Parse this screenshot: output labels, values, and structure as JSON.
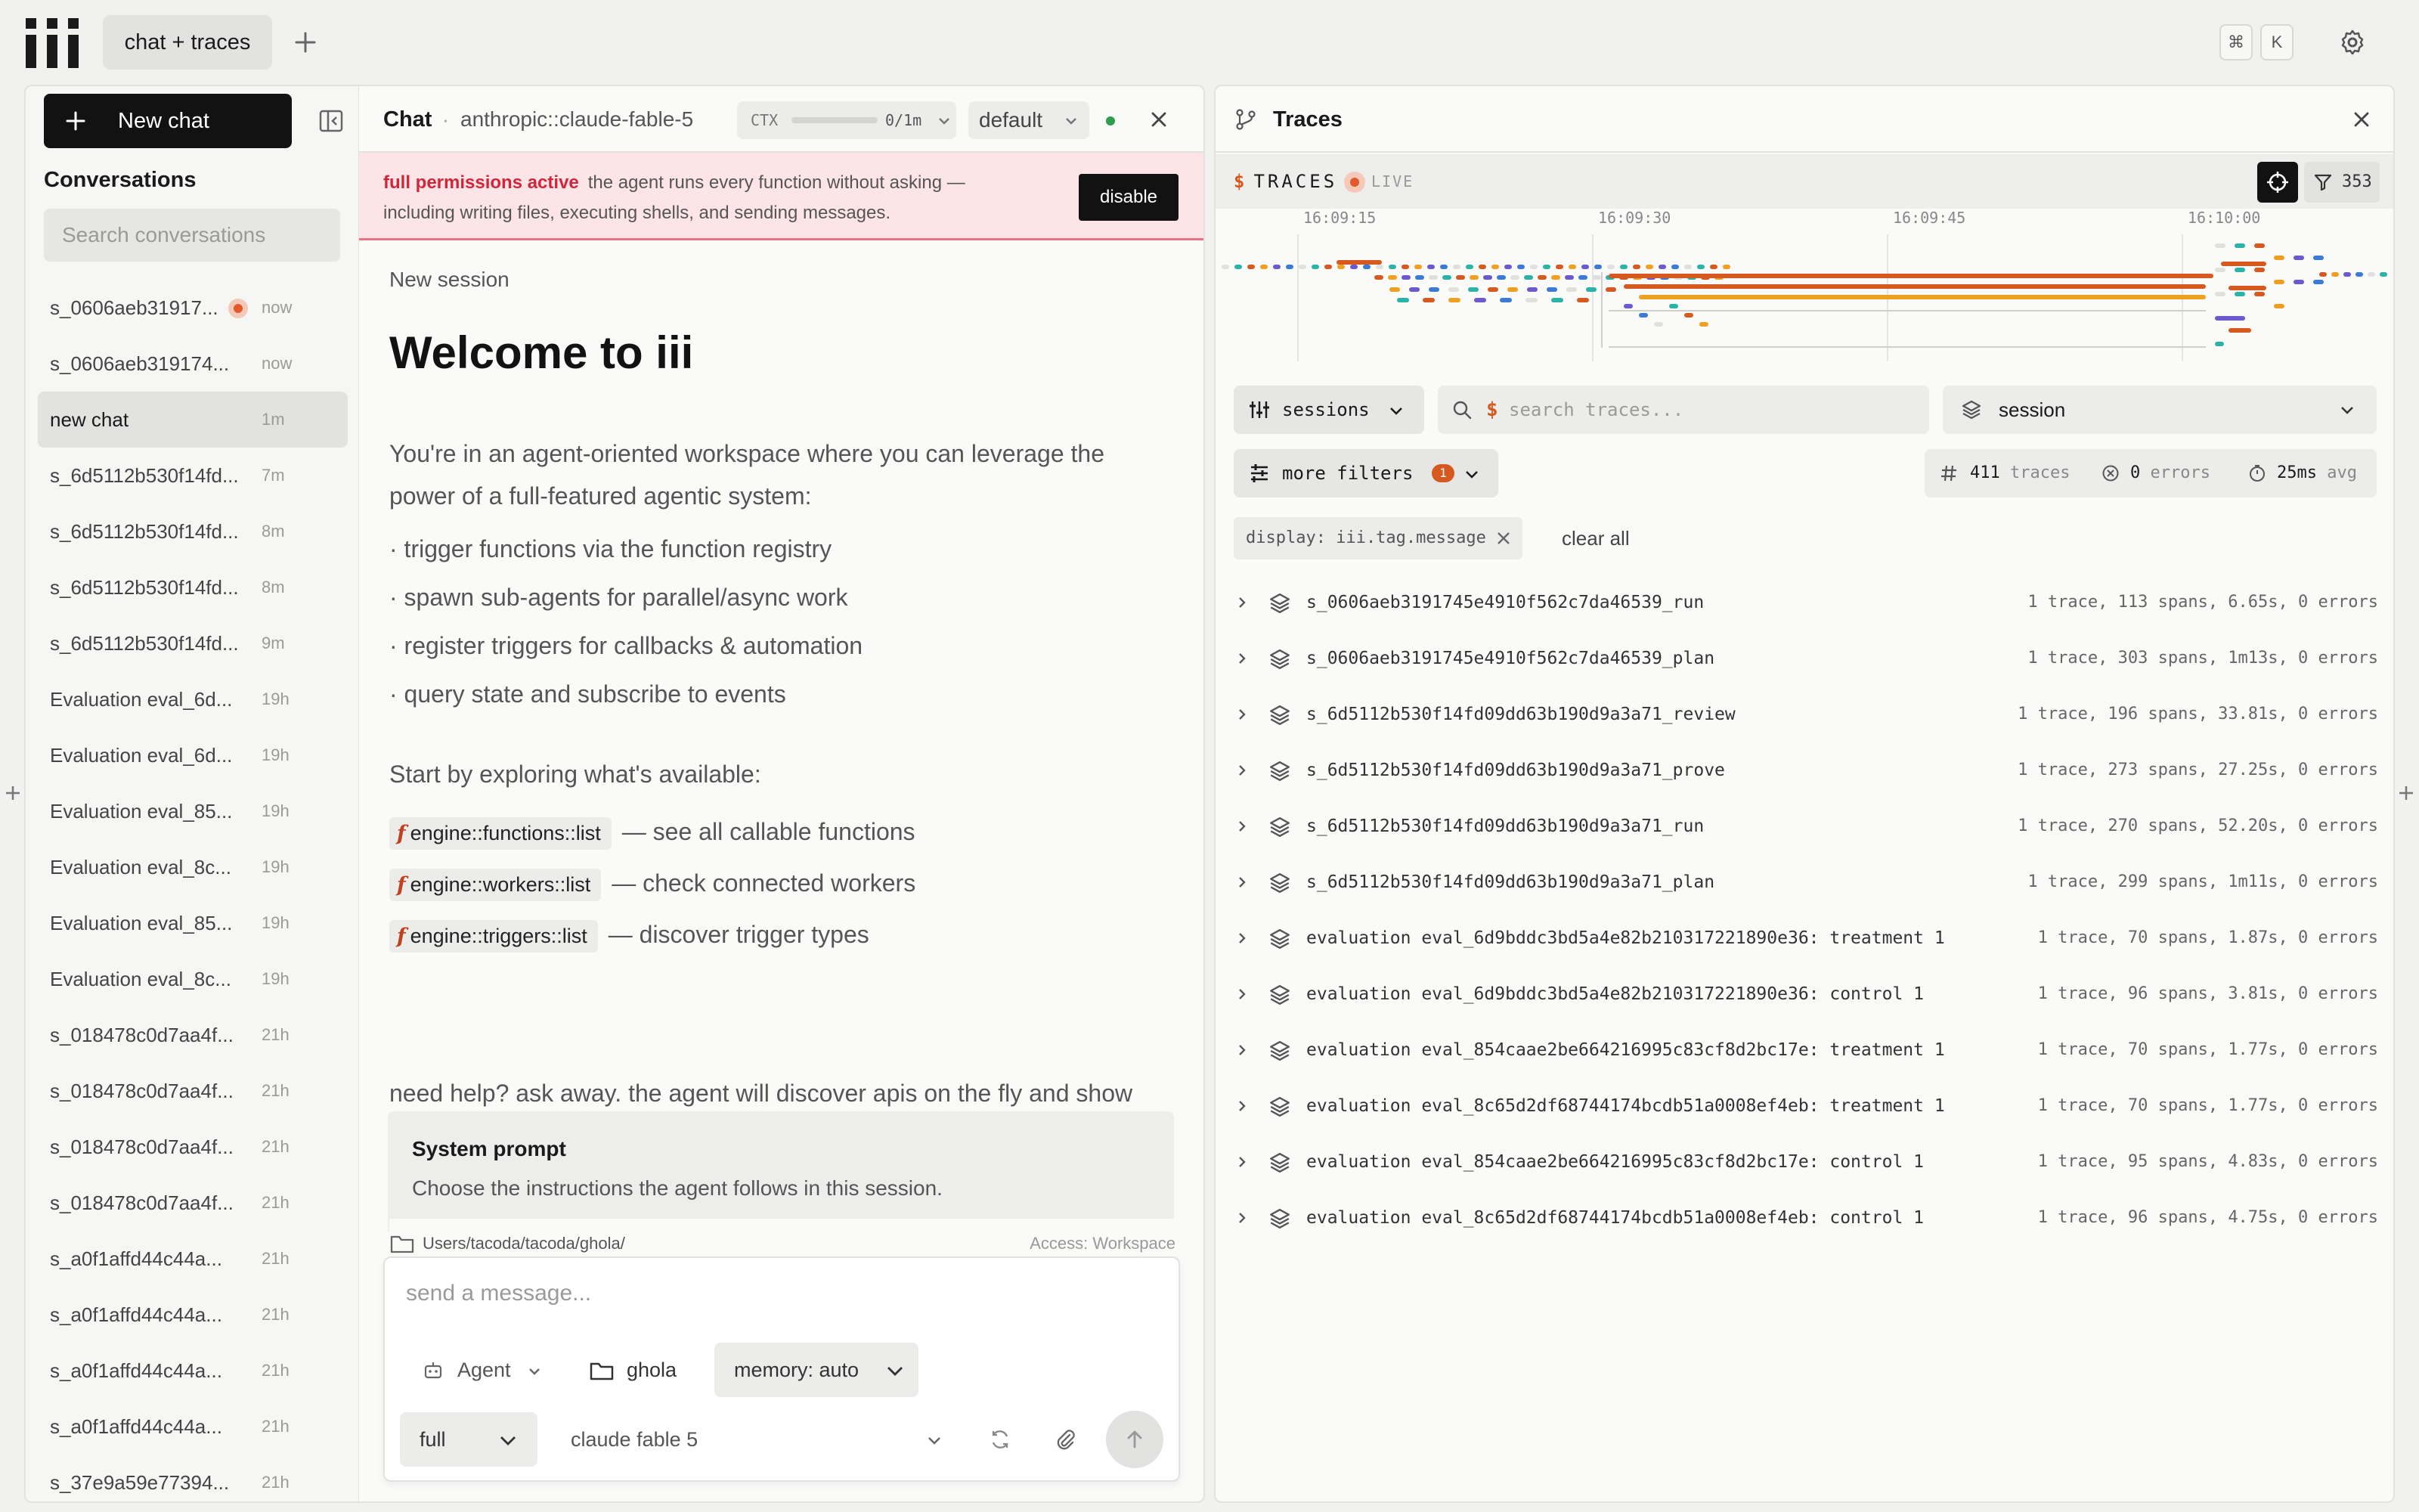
{
  "tabs": {
    "active": "chat + traces"
  },
  "shortcut": {
    "mod": "⌘",
    "key": "K"
  },
  "sidebar": {
    "new_chat": "New chat",
    "title": "Conversations",
    "search_placeholder": "Search conversations",
    "items": [
      {
        "name": "s_0606aeb31917...",
        "time": "now",
        "live": true
      },
      {
        "name": "s_0606aeb319174...",
        "time": "now"
      },
      {
        "name": "new chat",
        "time": "1m",
        "active": true
      },
      {
        "name": "s_6d5112b530f14fd...",
        "time": "7m"
      },
      {
        "name": "s_6d5112b530f14fd...",
        "time": "8m"
      },
      {
        "name": "s_6d5112b530f14fd...",
        "time": "8m"
      },
      {
        "name": "s_6d5112b530f14fd...",
        "time": "9m"
      },
      {
        "name": "Evaluation eval_6d...",
        "time": "19h"
      },
      {
        "name": "Evaluation eval_6d...",
        "time": "19h"
      },
      {
        "name": "Evaluation eval_85...",
        "time": "19h"
      },
      {
        "name": "Evaluation eval_8c...",
        "time": "19h"
      },
      {
        "name": "Evaluation eval_85...",
        "time": "19h"
      },
      {
        "name": "Evaluation eval_8c...",
        "time": "19h"
      },
      {
        "name": "s_018478c0d7aa4f...",
        "time": "21h"
      },
      {
        "name": "s_018478c0d7aa4f...",
        "time": "21h"
      },
      {
        "name": "s_018478c0d7aa4f...",
        "time": "21h"
      },
      {
        "name": "s_018478c0d7aa4f...",
        "time": "21h"
      },
      {
        "name": "s_a0f1affd44c44a...",
        "time": "21h"
      },
      {
        "name": "s_a0f1affd44c44a...",
        "time": "21h"
      },
      {
        "name": "s_a0f1affd44c44a...",
        "time": "21h"
      },
      {
        "name": "s_a0f1affd44c44a...",
        "time": "21h"
      },
      {
        "name": "s_37e9a59e77394...",
        "time": "21h"
      }
    ]
  },
  "chat": {
    "title": "Chat",
    "separator": "·",
    "model": "anthropic::claude-fable-5",
    "ctx_label": "CTX",
    "ctx_value": "0/1m",
    "mode": "default",
    "permission": {
      "title": "full permissions active",
      "text": "the agent runs every function without asking — including writing files, executing shells, and sending messages.",
      "button": "disable"
    },
    "session_label": "New session",
    "welcome": "Welcome to iii",
    "intro": "You're in an agent-oriented workspace where you can leverage the power of a full-featured agentic system:",
    "bullets": [
      "· trigger functions via the function registry",
      "· spawn sub-agents for parallel/async work",
      "· register triggers for callbacks & automation",
      "· query state and subscribe to events"
    ],
    "start_by": "Start by exploring what's available:",
    "functions": [
      {
        "name": "engine::functions::list",
        "desc": "— see all callable functions"
      },
      {
        "name": "engine::workers::list",
        "desc": "— check connected workers"
      },
      {
        "name": "engine::triggers::list",
        "desc": "— discover trigger types"
      }
    ],
    "fn_glyph": "f",
    "help": "need help? ask away. the agent will discover apis on the fly and show you what's possible.",
    "system_prompt": {
      "title": "System prompt",
      "desc": "Choose the instructions the agent follows in this session."
    },
    "path": "Users/tacoda/tacoda/ghola/",
    "access": "Access: Workspace",
    "composer": {
      "placeholder": "send a message...",
      "agent": "Agent",
      "folder": "ghola",
      "memory": "memory: auto",
      "perm": "full",
      "model": "claude fable 5"
    }
  },
  "traces": {
    "title": "Traces",
    "bar_symbol": "$",
    "bar_label": "TRACES",
    "live": "LIVE",
    "filter_count": "353",
    "ticks": [
      "16:09:15",
      "16:09:30",
      "16:09:45",
      "16:10:00"
    ],
    "sessions_btn": "sessions",
    "search_symbol": "$",
    "search_placeholder": "search traces...",
    "group_by": "session",
    "more_filters": "more filters",
    "more_filters_count": "1",
    "stats": {
      "traces_n": "411",
      "traces_l": "traces",
      "errors_n": "0",
      "errors_l": "errors",
      "avg_n": "25ms",
      "avg_l": "avg"
    },
    "display_chip": "display: iii.tag.message",
    "clear_all": "clear all",
    "rows": [
      {
        "name": "s_0606aeb3191745e4910f562c7da46539_run",
        "meta": "1 trace, 113 spans, 6.65s, 0 errors"
      },
      {
        "name": "s_0606aeb3191745e4910f562c7da46539_plan",
        "meta": "1 trace, 303 spans, 1m13s, 0 errors"
      },
      {
        "name": "s_6d5112b530f14fd09dd63b190d9a3a71_review",
        "meta": "1 trace, 196 spans, 33.81s, 0 errors"
      },
      {
        "name": "s_6d5112b530f14fd09dd63b190d9a3a71_prove",
        "meta": "1 trace, 273 spans, 27.25s, 0 errors"
      },
      {
        "name": "s_6d5112b530f14fd09dd63b190d9a3a71_run",
        "meta": "1 trace, 270 spans, 52.20s, 0 errors"
      },
      {
        "name": "s_6d5112b530f14fd09dd63b190d9a3a71_plan",
        "meta": "1 trace, 299 spans, 1m11s, 0 errors"
      },
      {
        "name": "evaluation eval_6d9bddc3bd5a4e82b210317221890e36: treatment 1",
        "meta": "1 trace, 70 spans, 1.87s, 0 errors"
      },
      {
        "name": "evaluation eval_6d9bddc3bd5a4e82b210317221890e36: control 1",
        "meta": "1 trace, 96 spans, 3.81s, 0 errors"
      },
      {
        "name": "evaluation eval_854caae2be664216995c83cf8d2bc17e: treatment 1",
        "meta": "1 trace, 70 spans, 1.77s, 0 errors"
      },
      {
        "name": "evaluation eval_8c65d2df68744174bcdb51a0008ef4eb: treatment 1",
        "meta": "1 trace, 70 spans, 1.77s, 0 errors"
      },
      {
        "name": "evaluation eval_854caae2be664216995c83cf8d2bc17e: control 1",
        "meta": "1 trace, 95 spans, 4.83s, 0 errors"
      },
      {
        "name": "evaluation eval_8c65d2df68744174bcdb51a0008ef4eb: control 1",
        "meta": "1 trace, 96 spans, 4.75s, 0 errors"
      }
    ]
  },
  "colors": {
    "accent": "#d65a1f",
    "danger": "#d0263a",
    "ok": "#2e9d4e",
    "dark": "#121212"
  }
}
